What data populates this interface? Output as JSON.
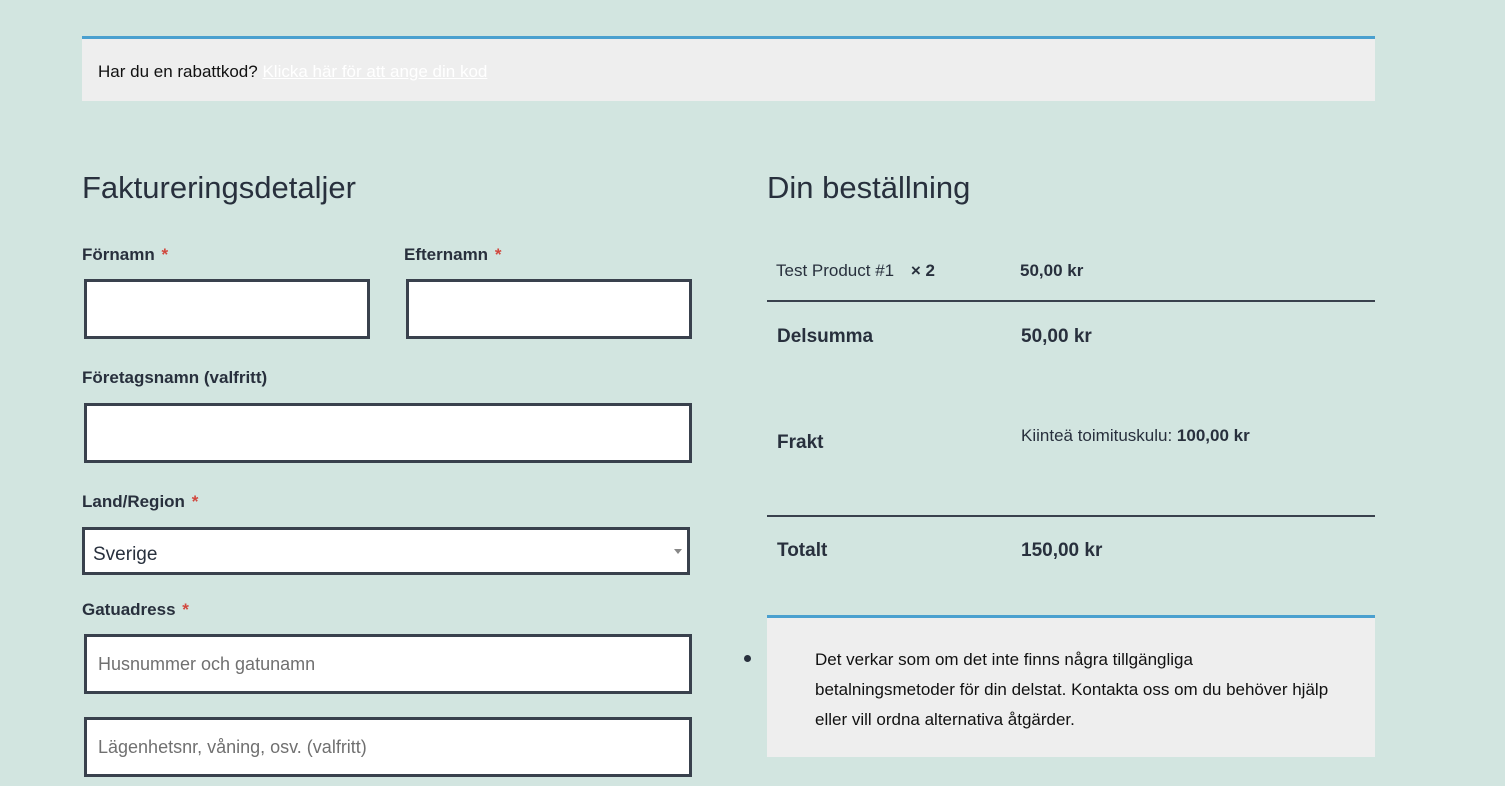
{
  "coupon": {
    "question": "Har du en rabattkod?",
    "link": "Klicka här för att ange din kod"
  },
  "billing": {
    "title": "Faktureringsdetaljer",
    "first_name_label": "Förnamn",
    "last_name_label": "Efternamn",
    "company_label": "Företagsnamn",
    "company_optional": "(valfritt)",
    "country_label": "Land/Region",
    "country_value": "Sverige",
    "street_label": "Gatuadress",
    "street_placeholder": "Husnummer och gatunamn",
    "apartment_placeholder": "Lägenhetsnr, våning, osv. (valfritt)",
    "required_mark": "*"
  },
  "order": {
    "title": "Din beställning",
    "item_name": "Test Product #1",
    "item_qty": "× 2",
    "item_total": "50,00 kr",
    "subtotal_label": "Delsumma",
    "subtotal_value": "50,00 kr",
    "shipping_label": "Frakt",
    "shipping_method": "Kiinteä toimituskulu:",
    "shipping_value": "100,00 kr",
    "total_label": "Totalt",
    "total_value": "150,00 kr",
    "payment_notice": "Det verkar som om det inte finns några tillgängliga betalningsmetoder för din delstat. Kontakta oss om du behöver hjälp eller vill ordna alternativa åtgärder."
  },
  "colors": {
    "background": "#d2e5e0",
    "accent": "#4aa0cf",
    "required": "#d1473d"
  }
}
